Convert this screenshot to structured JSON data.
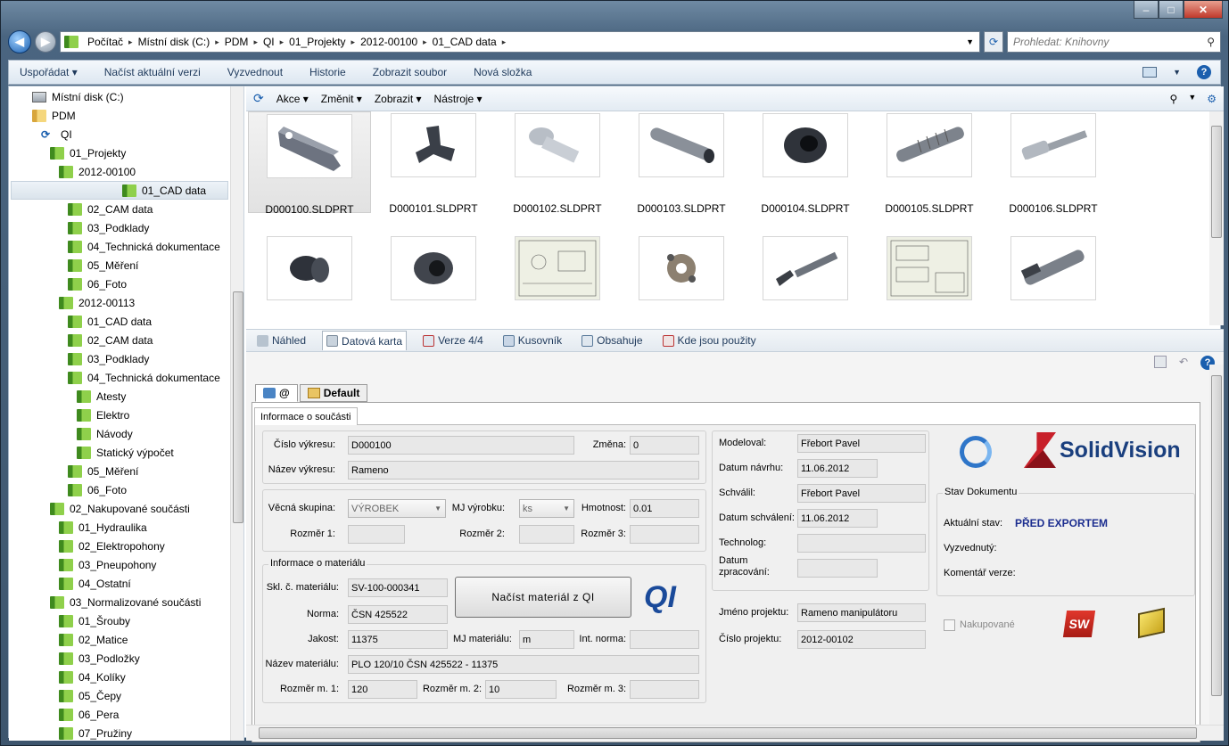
{
  "window": {
    "min": "‒",
    "max": "□",
    "close": "✕"
  },
  "address": {
    "crumbs": [
      "Počítač",
      "Místní disk (C:)",
      "PDM",
      "QI",
      "01_Projekty",
      "2012-00100",
      "01_CAD data"
    ],
    "search_placeholder": "Prohledat: Knihovny"
  },
  "commands": [
    "Uspořádat ▾",
    "Načíst aktuální verzi",
    "Vyzvednout",
    "Historie",
    "Zobrazit soubor",
    "Nová složka"
  ],
  "tree": [
    {
      "label": "Místní disk (C:)",
      "indent": 0,
      "icon": "drive"
    },
    {
      "label": "PDM",
      "indent": 1,
      "icon": "folder-yellow"
    },
    {
      "label": "QI",
      "indent": 2,
      "icon": "vault"
    },
    {
      "label": "01_Projekty",
      "indent": 3,
      "icon": "folder"
    },
    {
      "label": "2012-00100",
      "indent": 4,
      "icon": "folder"
    },
    {
      "label": "01_CAD data",
      "indent": 5,
      "icon": "folder",
      "selected": true
    },
    {
      "label": "02_CAM data",
      "indent": 5,
      "icon": "folder"
    },
    {
      "label": "03_Podklady",
      "indent": 5,
      "icon": "folder"
    },
    {
      "label": "04_Technická dokumentace",
      "indent": 5,
      "icon": "folder"
    },
    {
      "label": "05_Měření",
      "indent": 5,
      "icon": "folder"
    },
    {
      "label": "06_Foto",
      "indent": 5,
      "icon": "folder"
    },
    {
      "label": "2012-00113",
      "indent": 4,
      "icon": "folder"
    },
    {
      "label": "01_CAD data",
      "indent": 5,
      "icon": "folder"
    },
    {
      "label": "02_CAM data",
      "indent": 5,
      "icon": "folder"
    },
    {
      "label": "03_Podklady",
      "indent": 5,
      "icon": "folder"
    },
    {
      "label": "04_Technická dokumentace",
      "indent": 5,
      "icon": "folder"
    },
    {
      "label": "Atesty",
      "indent": 6,
      "icon": "folder"
    },
    {
      "label": "Elektro",
      "indent": 6,
      "icon": "folder"
    },
    {
      "label": "Návody",
      "indent": 6,
      "icon": "folder"
    },
    {
      "label": "Statický výpočet",
      "indent": 6,
      "icon": "folder"
    },
    {
      "label": "05_Měření",
      "indent": 5,
      "icon": "folder"
    },
    {
      "label": "06_Foto",
      "indent": 5,
      "icon": "folder"
    },
    {
      "label": "02_Nakupované součásti",
      "indent": 3,
      "icon": "folder"
    },
    {
      "label": "01_Hydraulika",
      "indent": 4,
      "icon": "folder"
    },
    {
      "label": "02_Elektropohony",
      "indent": 4,
      "icon": "folder"
    },
    {
      "label": "03_Pneupohony",
      "indent": 4,
      "icon": "folder"
    },
    {
      "label": "04_Ostatní",
      "indent": 4,
      "icon": "folder"
    },
    {
      "label": "03_Normalizované součásti",
      "indent": 3,
      "icon": "folder"
    },
    {
      "label": "01_Šrouby",
      "indent": 4,
      "icon": "folder"
    },
    {
      "label": "02_Matice",
      "indent": 4,
      "icon": "folder"
    },
    {
      "label": "03_Podložky",
      "indent": 4,
      "icon": "folder"
    },
    {
      "label": "04_Kolíky",
      "indent": 4,
      "icon": "folder"
    },
    {
      "label": "05_Čepy",
      "indent": 4,
      "icon": "folder"
    },
    {
      "label": "06_Pera",
      "indent": 4,
      "icon": "folder"
    },
    {
      "label": "07_Pružiny",
      "indent": 4,
      "icon": "folder"
    }
  ],
  "toolbar2": [
    "Akce ▾",
    "Změnit ▾",
    "Zobrazit ▾",
    "Nástroje ▾"
  ],
  "files": [
    {
      "name": "D000100.SLDPRT",
      "kind": "arm",
      "selected": true
    },
    {
      "name": "D000101.SLDPRT",
      "kind": "bracket"
    },
    {
      "name": "D000102.SLDPRT",
      "kind": "bolt"
    },
    {
      "name": "D000103.SLDPRT",
      "kind": "tube"
    },
    {
      "name": "D000104.SLDPRT",
      "kind": "ring"
    },
    {
      "name": "D000105.SLDPRT",
      "kind": "screw"
    },
    {
      "name": "D000106.SLDPRT",
      "kind": "rod"
    },
    {
      "name": "",
      "kind": "cap"
    },
    {
      "name": "",
      "kind": "cap2"
    },
    {
      "name": "",
      "kind": "drawing"
    },
    {
      "name": "",
      "kind": "gear"
    },
    {
      "name": "",
      "kind": "gripper"
    },
    {
      "name": "",
      "kind": "drawing2"
    },
    {
      "name": "",
      "kind": "cylinder"
    }
  ],
  "tabs": [
    "Náhled",
    "Datová karta",
    "Verze 4/4",
    "Kusovník",
    "Obsahuje",
    "Kde jsou použity"
  ],
  "subtabs": [
    "@",
    "Default"
  ],
  "card": {
    "tab": "Informace o součásti",
    "cislo_vykresu_l": "Číslo výkresu:",
    "cislo_vykresu": "D000100",
    "zmena_l": "Změna:",
    "zmena": "0",
    "nazev_vykresu_l": "Název výkresu:",
    "nazev_vykresu": "Rameno",
    "vecna_skupina_l": "Věcná skupina:",
    "vecna_skupina": "VÝROBEK",
    "mj_vyrobku_l": "MJ výrobku:",
    "mj_vyrobku": "ks",
    "hmotnost_l": "Hmotnost:",
    "hmotnost": "0.01",
    "rozmer1_l": "Rozměr 1:",
    "rozmer2_l": "Rozměr 2:",
    "rozmer3_l": "Rozměr 3:",
    "mat_group": "Informace o materiálu",
    "skl_l": "Skl. č. materiálu:",
    "skl": "SV-100-000341",
    "norma_l": "Norma:",
    "norma": "ČSN 425522",
    "jakost_l": "Jakost:",
    "jakost": "11375",
    "mj_mat_l": "MJ materiálu:",
    "mj_mat": "m",
    "int_norma_l": "Int. norma:",
    "nazev_mat_l": "Název materiálu:",
    "nazev_mat": "PLO 120/10 ČSN 425522 - 11375",
    "rm1_l": "Rozměr m. 1:",
    "rm1": "120",
    "rm2_l": "Rozměr m. 2:",
    "rm2": "10",
    "rm3_l": "Rozměr m. 3:",
    "nacist_btn": "Načíst materiál z QI",
    "modeloval_l": "Modeloval:",
    "modeloval": "Fřebort Pavel",
    "datum_navrhu_l": "Datum návrhu:",
    "datum_navrhu": "11.06.2012",
    "schvalil_l": "Schválil:",
    "schvalil": "Fřebort Pavel",
    "datum_schvaleni_l": "Datum schválení:",
    "datum_schvaleni": "11.06.2012",
    "technolog_l": "Technolog:",
    "datum_zprac_l1": "Datum",
    "datum_zprac_l2": "zpracování:",
    "jmeno_projektu_l": "Jméno projektu:",
    "jmeno_projektu": "Rameno manipulátoru",
    "cislo_projektu_l": "Číslo projektu:",
    "cislo_projektu": "2012-00102",
    "stav_group": "Stav Dokumentu",
    "aktualni_stav_l": "Aktuální stav:",
    "aktualni_stav": "PŘED EXPORTEM",
    "vyzvednuty_l": "Vyzvednutý:",
    "komentar_l": "Komentář verze:",
    "nakupovane": "Nakupované",
    "logo": "SolidVision",
    "qi_logo": "QI"
  },
  "colors": {
    "stav": "#1b2d8f",
    "accent": "#1e395b"
  }
}
